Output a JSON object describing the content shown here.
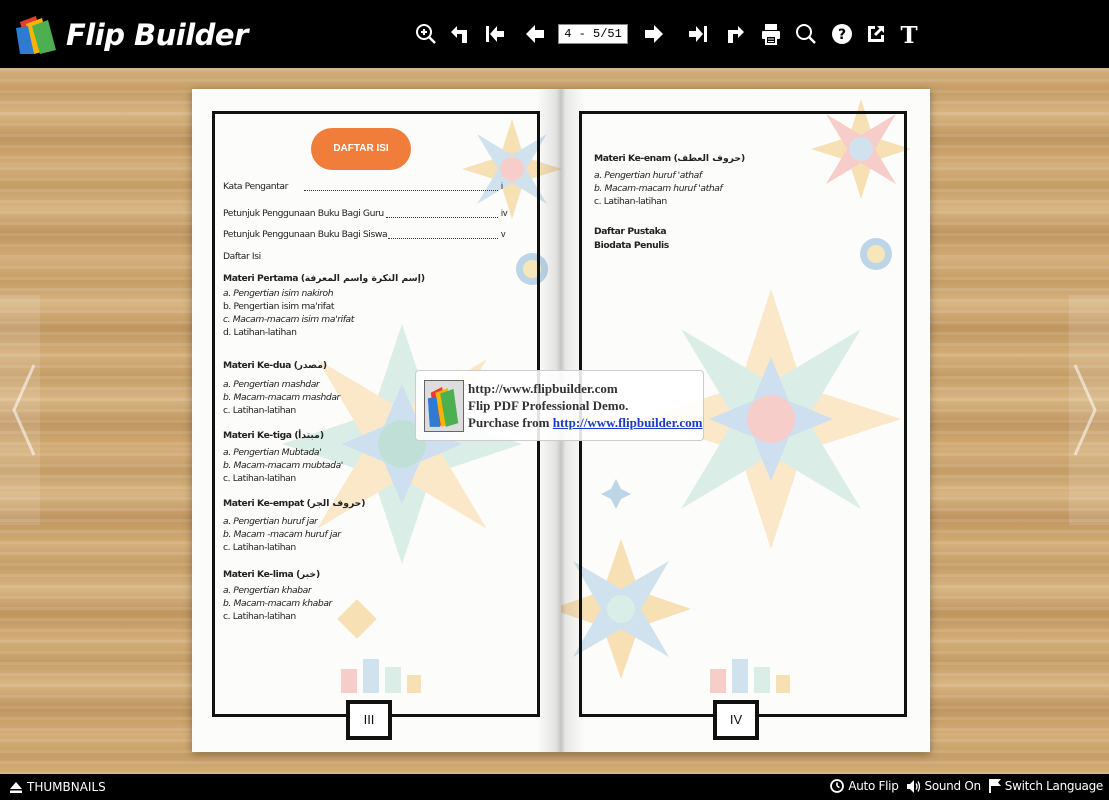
{
  "app": {
    "brand": "Flip Builder",
    "page_indicator": "4 - 5/51"
  },
  "toolbar": {
    "icons": [
      "zoom-in-icon",
      "undo-icon",
      "first-page-icon",
      "previous-page-icon",
      "next-page-icon",
      "last-page-icon",
      "forward-icon",
      "print-icon",
      "search-icon",
      "help-icon",
      "share-icon",
      "text-icon"
    ]
  },
  "left_page": {
    "header": "DAFTAR ISI",
    "page_number": "III",
    "entries": [
      {
        "label": "Kata Pengantar ",
        "page": "i"
      },
      {
        "label": "Petunjuk Penggunaan Buku Bagi Guru",
        "page": "iv"
      },
      {
        "label": "Petunjuk Penggunaan Buku Bagi Siswa",
        "page": "v"
      },
      {
        "label": "Daftar Isi"
      }
    ],
    "sections": [
      {
        "title": "Materi Pertama (إسم النكرة واسم المعرفة)",
        "items": [
          "a. Pengertian isim nakiroh",
          "b. Pengertian isim ma'rifat",
          "c. Macam-macam isim ma'rifat",
          "d. Latihan-latihan"
        ]
      },
      {
        "title": "Materi Ke-dua (مصدر)",
        "items": [
          "a. Pengertian mashdar",
          "b. Macam-macam mashdar",
          "c. Latihan-latihan"
        ]
      },
      {
        "title": "Materi Ke-tiga (مبتدأ)",
        "items": [
          "a. Pengertian Mubtada'",
          "b. Macam-macam mubtada'",
          "c. Latihan-latihan"
        ]
      },
      {
        "title": "Materi Ke-empat (حروف الجر)",
        "items": [
          "a. Pengertian huruf jar",
          "b. Macam -macam huruf jar",
          "c. Latihan-latihan"
        ]
      },
      {
        "title": "Materi Ke-lima (خبر)",
        "items": [
          "a. Pengertian khabar",
          "b. Macam-macam khabar",
          "c. Latihan-latihan"
        ]
      }
    ]
  },
  "right_page": {
    "page_number": "IV",
    "section": {
      "title": "Materi Ke-enam (حروف العطف)",
      "items": [
        "a. Pengertian huruf 'athaf",
        "b. Macam-macam huruf 'athaf",
        "c. Latihan-latihan"
      ]
    },
    "extras": [
      "Daftar Pustaka",
      "Biodata Penulis"
    ]
  },
  "watermark": {
    "line1": "http://www.flipbuilder.com",
    "line2": "Flip PDF Professional Demo.",
    "line3_prefix": "Purchase from ",
    "line3_link": "http://www.flipbuilder.com"
  },
  "bottombar": {
    "thumbnails": "THUMBNAILS",
    "auto_flip": "Auto Flip",
    "sound": "Sound On",
    "language": "Switch Language"
  },
  "colors": {
    "toc_header_bg": "#f07d3a",
    "toolbar_bg": "#000000",
    "link": "#1b3ac9"
  }
}
